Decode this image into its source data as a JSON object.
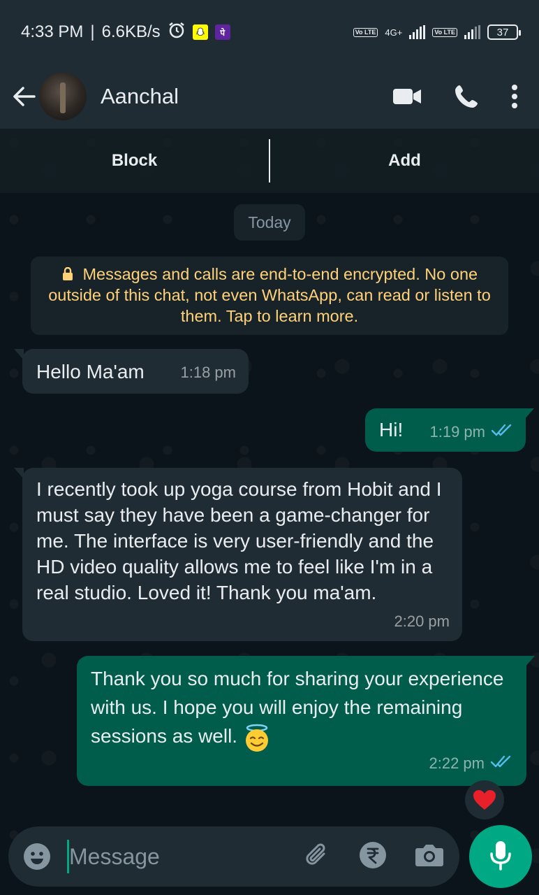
{
  "status_bar": {
    "time": "4:33 PM",
    "speed": "6.6KB/s",
    "volte_label": "Vo LTE",
    "network_label": "4G+",
    "battery": "37"
  },
  "header": {
    "contact_name": "Aanchal",
    "icons": [
      "back-arrow-icon",
      "video-call-icon",
      "phone-icon",
      "more-vert-icon"
    ]
  },
  "action_bar": {
    "block_label": "Block",
    "add_label": "Add"
  },
  "chat": {
    "date_chip": "Today",
    "encryption_notice": "Messages and calls are end-to-end encrypted. No one outside of this chat, not even WhatsApp, can read or listen to them. Tap to learn more.",
    "messages": [
      {
        "direction": "in",
        "text": "Hello Ma'am",
        "time": "1:18 pm"
      },
      {
        "direction": "out",
        "text": "Hi!",
        "time": "1:19 pm",
        "status": "read"
      },
      {
        "direction": "in",
        "text": "I recently took up yoga course from Hobit and I must say they have been a game-changer for me. The interface is very user-friendly and the HD video quality allows me to feel like I'm in a real studio. Loved it! Thank you ma'am.",
        "time": "2:20 pm"
      },
      {
        "direction": "out",
        "text": "Thank you so much for sharing your experience with us. I hope you will enjoy the remaining sessions as well.",
        "emoji": "smiling-face-with-halo",
        "time": "2:22 pm",
        "status": "read",
        "reaction": "red-heart"
      }
    ]
  },
  "composer": {
    "placeholder": "Message"
  },
  "colors": {
    "background": "#0b141a",
    "header": "#1f2c34",
    "incoming": "#202c33",
    "outgoing": "#005c4b",
    "accent": "#00a884",
    "read_ticks": "#53bdeb",
    "notice_text": "#ffd279"
  }
}
